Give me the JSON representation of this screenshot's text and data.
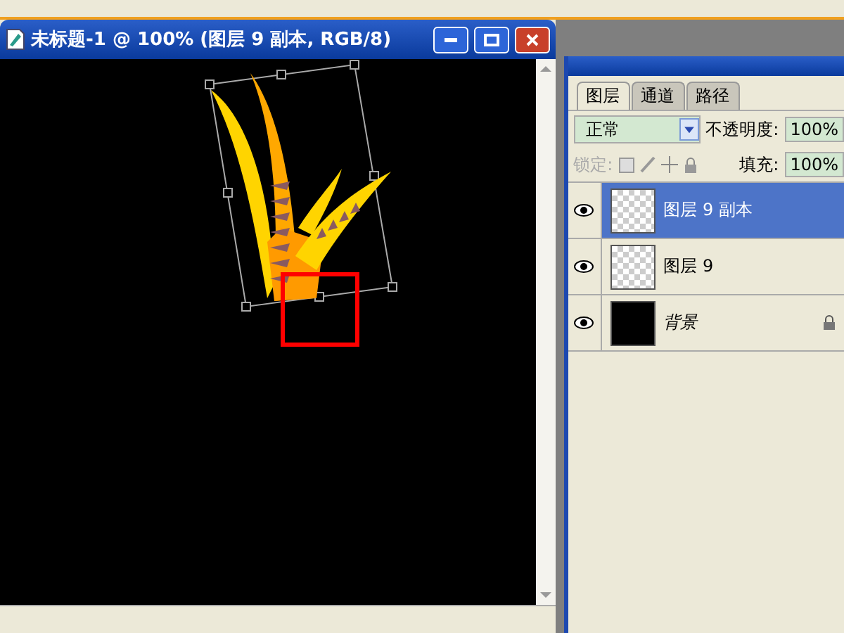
{
  "document": {
    "title": "未标题-1 @ 100% (图层 9 副本, RGB/8)"
  },
  "layers_panel": {
    "tabs": [
      {
        "label": "图层",
        "selected": true
      },
      {
        "label": "通道",
        "selected": false
      },
      {
        "label": "路径",
        "selected": false
      }
    ],
    "blend_mode": "正常",
    "opacity_label": "不透明度:",
    "opacity": "100%",
    "lock_label": "锁定:",
    "fill_label": "填充:",
    "fill": "100%",
    "layers": [
      {
        "name": "图层 9 副本",
        "kind": "layer",
        "selected": true,
        "visible": true,
        "locked": false
      },
      {
        "name": "图层 9",
        "kind": "layer",
        "selected": false,
        "visible": true,
        "locked": false
      },
      {
        "name": "背景",
        "kind": "background",
        "selected": false,
        "visible": true,
        "locked": true
      }
    ]
  }
}
